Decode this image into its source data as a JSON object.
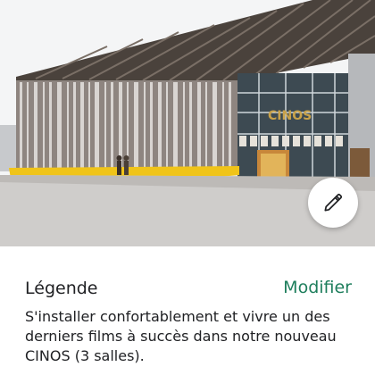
{
  "photo": {
    "sign_text": "CINOS",
    "alt": "photo-cinema-facade"
  },
  "edit_button": {
    "icon": "pencil-icon"
  },
  "caption": {
    "title": "Légende",
    "action_label": "Modifier",
    "text": "S'installer confortablement et vivre un des derniers films à succès dans notre nouveau CINOS (3 salles)."
  },
  "colors": {
    "accent": "#1e7e5c",
    "text": "#202124",
    "facade_yellow": "#f0c419",
    "roof_dark": "#3a3430"
  }
}
